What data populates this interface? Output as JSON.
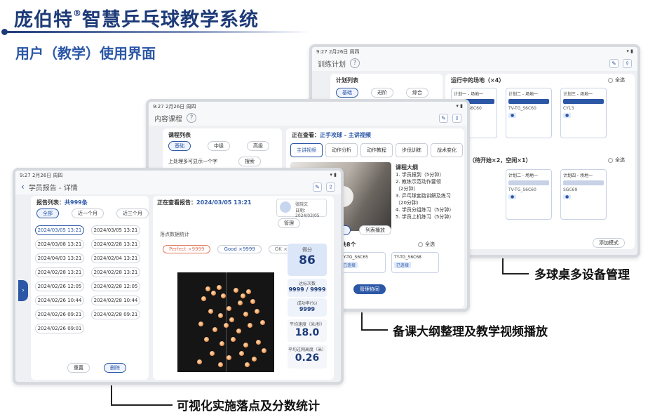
{
  "slide": {
    "title": "庞伯特",
    "title_rest": "智慧乒乓球教学系统",
    "reg_mark": "®",
    "subtitle": "用户（教学）使用界面"
  },
  "captions": {
    "device_mgmt": "多球桌多设备管理",
    "lesson_prep": "备课大纲整理及教学视频播放",
    "visual_stats": "可视化实施落点及分数统计"
  },
  "tablet3": {
    "status_time": "9:27  2月26日 周四",
    "page_title": "训练计划",
    "plan_list_label": "计划列表",
    "filters": [
      "基础",
      "进阶",
      "综合"
    ],
    "running_label": "运行中的场地（×4）",
    "queued_label": "（待开始×2，空闲×1）",
    "select_all": "全选",
    "card_titles": [
      "计划一 - 场地一",
      "计划二 - 场地一",
      "计划三 - 场地一",
      "计划四 - 场地一"
    ],
    "card_codes": [
      "TV-TG_S6C60",
      "TV-TG_S6C60",
      "CY13",
      "SGC69"
    ],
    "bottom_button": "添加模式"
  },
  "tablet2": {
    "status_time": "9:27  2月26日 周四",
    "page_title": "内容课程",
    "course_list_label": "课程列表",
    "filters": [
      "基础",
      "中级",
      "高级"
    ],
    "hint": "上处理多可显示一个字",
    "hint_button": "搜索",
    "viewing_label": "正在查看：",
    "viewing_value": "正手攻球 - 主讲视频",
    "tabs": [
      "主讲视频",
      "动作分析",
      "动作教程",
      "步伐训练",
      "战术变化",
      "训练"
    ],
    "outline_title": "课程大纲",
    "outline_items": [
      "1. 学员报到（5分钟）",
      "2. 教练示范动作要领",
      "（2分钟）",
      "3. 乒乓球套路讲解及练习（20分钟）",
      "4. 学员分组练习（5分钟）",
      "5. 学员上机练习（5分钟）"
    ],
    "video_btn1": "播放",
    "video_btn2": "列表播放",
    "devices_label": "2个 / 共8个",
    "select_all": "全选",
    "device_cards": [
      "TY-TG_S6C65",
      "TY-TG_S6C68"
    ],
    "device_tag": "已连接",
    "sync_button": "管理协同"
  },
  "tablet1": {
    "status_time": "9:27  2月26日 周四",
    "page_title": "学员报告 - 详情",
    "report_list_label": "报告列表：",
    "report_count": "共999条",
    "range_filters": [
      "全部",
      "近一个月",
      "近三个月"
    ],
    "dates_col1": [
      "2024/03/05 13:21",
      "2024/03/08 13:21",
      "2024/04/03 13:21",
      "2024/02/28 13:21",
      "2024/02/26 12:05",
      "2024/02/26 10:44",
      "2024/02/26 09:21",
      "2024/02/26 09:01"
    ],
    "dates_col2": [
      "2024/03/05 13:21",
      "2024/02/28 13:21",
      "2024/02/04 13:21",
      "2024/02/28 13:21",
      "2024/02/28 12:05",
      "2024/02/28 10:44",
      "2024/02/28 09:21"
    ],
    "viewing_label": "正在查看报告：",
    "viewing_value": "2024/03/05  13:21",
    "student_name": "张晓文",
    "student_date": "日期：2024/03/05",
    "manage_btn": "管理",
    "chart_title": "落点数据统计",
    "legend": [
      "Perfect ×9999",
      "Good ×9999",
      "OK ×9999"
    ],
    "score_label": "得分",
    "score_value": "86",
    "count_label": "达标次数",
    "count_value": "9999 / 9999",
    "rate_label": "成功率(%)",
    "rate_value": "9999",
    "speed_label": "平均速度（米/秒）",
    "speed_value": "18.0",
    "height_label": "平均过网高度（米）",
    "height_value": "0.26",
    "btn_left": "重置",
    "btn_right": "删除",
    "accent_color": "#2b57a6"
  }
}
